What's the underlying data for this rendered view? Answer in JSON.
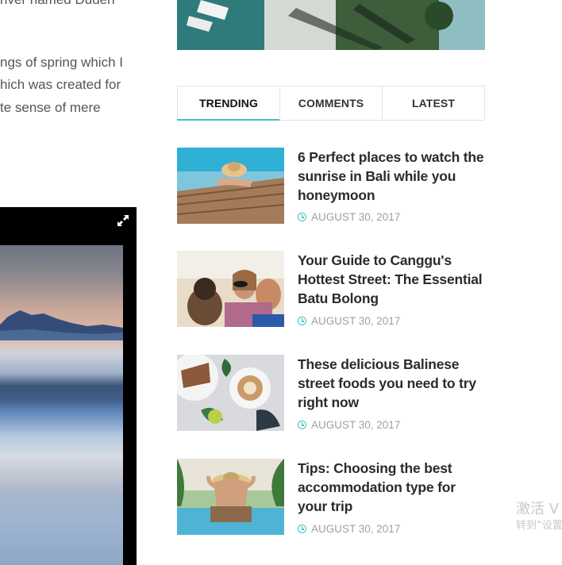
{
  "article": {
    "lines": [
      "river named Duden",
      "ngs of spring which I",
      "hich was created for",
      "te sense of mere"
    ]
  },
  "gallery": {
    "expand_icon": "expand-arrows-icon"
  },
  "sidebar": {
    "tabs": [
      {
        "label": "TRENDING",
        "active": true
      },
      {
        "label": "COMMENTS",
        "active": false
      },
      {
        "label": "LATEST",
        "active": false
      }
    ],
    "posts": [
      {
        "title": "6 Perfect places to watch the sunrise in Bali while you honeymoon",
        "date": "AUGUST 30, 2017"
      },
      {
        "title": "Your Guide to Canggu's Hottest Street: The Essential Batu Bolong",
        "date": "AUGUST 30, 2017"
      },
      {
        "title": "These delicious Balinese street foods you need to try right now",
        "date": "AUGUST 30, 2017"
      },
      {
        "title": "Tips: Choosing the best accommodation type for your trip",
        "date": "AUGUST 30, 2017"
      }
    ],
    "date_icon": "clock-icon"
  },
  "watermark": {
    "line1": "激活 V",
    "line2": "转到“设置"
  },
  "colors": {
    "accent": "#3ec1c2",
    "title": "#2b2b2b",
    "meta": "#a0a0a0"
  }
}
